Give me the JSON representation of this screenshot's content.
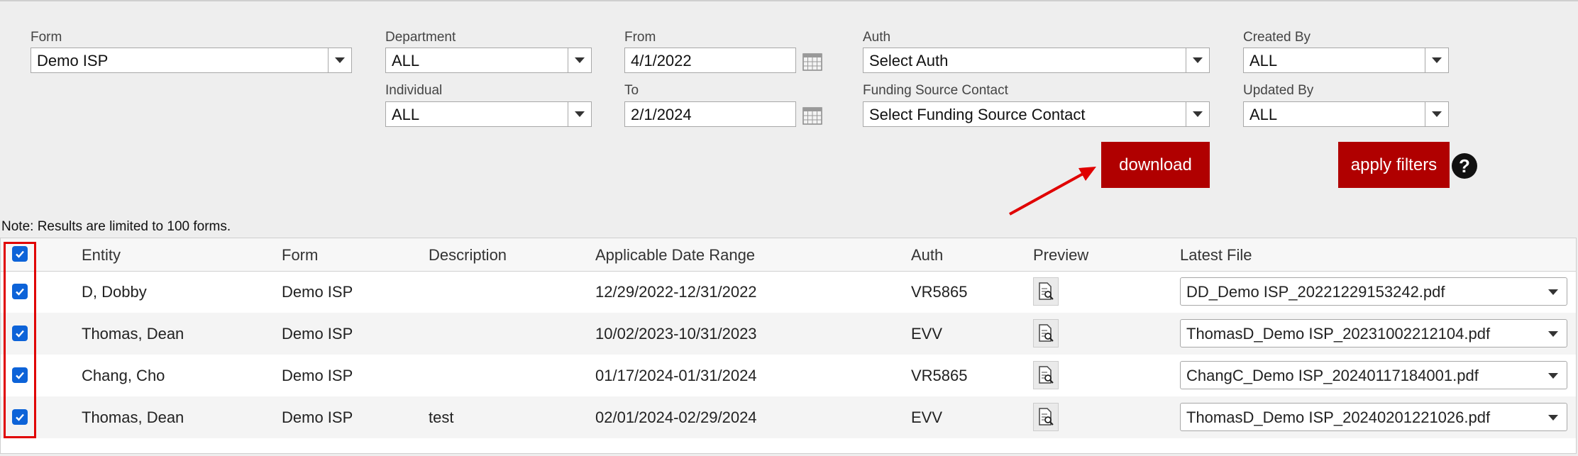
{
  "filters": {
    "form": {
      "label": "Form",
      "value": "Demo ISP"
    },
    "department": {
      "label": "Department",
      "value": "ALL"
    },
    "individual": {
      "label": "Individual",
      "value": "ALL"
    },
    "from": {
      "label": "From",
      "value": "4/1/2022"
    },
    "to": {
      "label": "To",
      "value": "2/1/2024"
    },
    "auth": {
      "label": "Auth",
      "value": "Select Auth"
    },
    "funding": {
      "label": "Funding Source Contact",
      "value": "Select Funding Source Contact"
    },
    "created_by": {
      "label": "Created By",
      "value": "ALL"
    },
    "updated_by": {
      "label": "Updated By",
      "value": "ALL"
    }
  },
  "buttons": {
    "download": "download",
    "apply": "apply filters",
    "help": "?"
  },
  "note": "Note: Results are limited to 100 forms.",
  "table": {
    "headers": {
      "entity": "Entity",
      "form": "Form",
      "description": "Description",
      "range": "Applicable Date Range",
      "auth": "Auth",
      "preview": "Preview",
      "file": "Latest File"
    },
    "rows": [
      {
        "entity": "D, Dobby",
        "form": "Demo ISP",
        "description": "",
        "range": "12/29/2022-12/31/2022",
        "auth": "VR5865",
        "file": "DD_Demo ISP_20221229153242.pdf"
      },
      {
        "entity": "Thomas, Dean",
        "form": "Demo ISP",
        "description": "",
        "range": "10/02/2023-10/31/2023",
        "auth": "EVV",
        "file": "ThomasD_Demo ISP_20231002212104.pdf"
      },
      {
        "entity": "Chang, Cho",
        "form": "Demo ISP",
        "description": "",
        "range": "01/17/2024-01/31/2024",
        "auth": "VR5865",
        "file": "ChangC_Demo ISP_20240117184001.pdf"
      },
      {
        "entity": "Thomas, Dean",
        "form": "Demo ISP",
        "description": "test",
        "range": "02/01/2024-02/29/2024",
        "auth": "EVV",
        "file": "ThomasD_Demo ISP_20240201221026.pdf"
      }
    ]
  },
  "colors": {
    "accent": "#b00000",
    "checkbox": "#0d63d8",
    "annotation": "#e00000"
  },
  "icons": [
    "chevron-down-icon",
    "calendar-icon",
    "help-icon",
    "checkmark-icon",
    "preview-document-icon"
  ]
}
